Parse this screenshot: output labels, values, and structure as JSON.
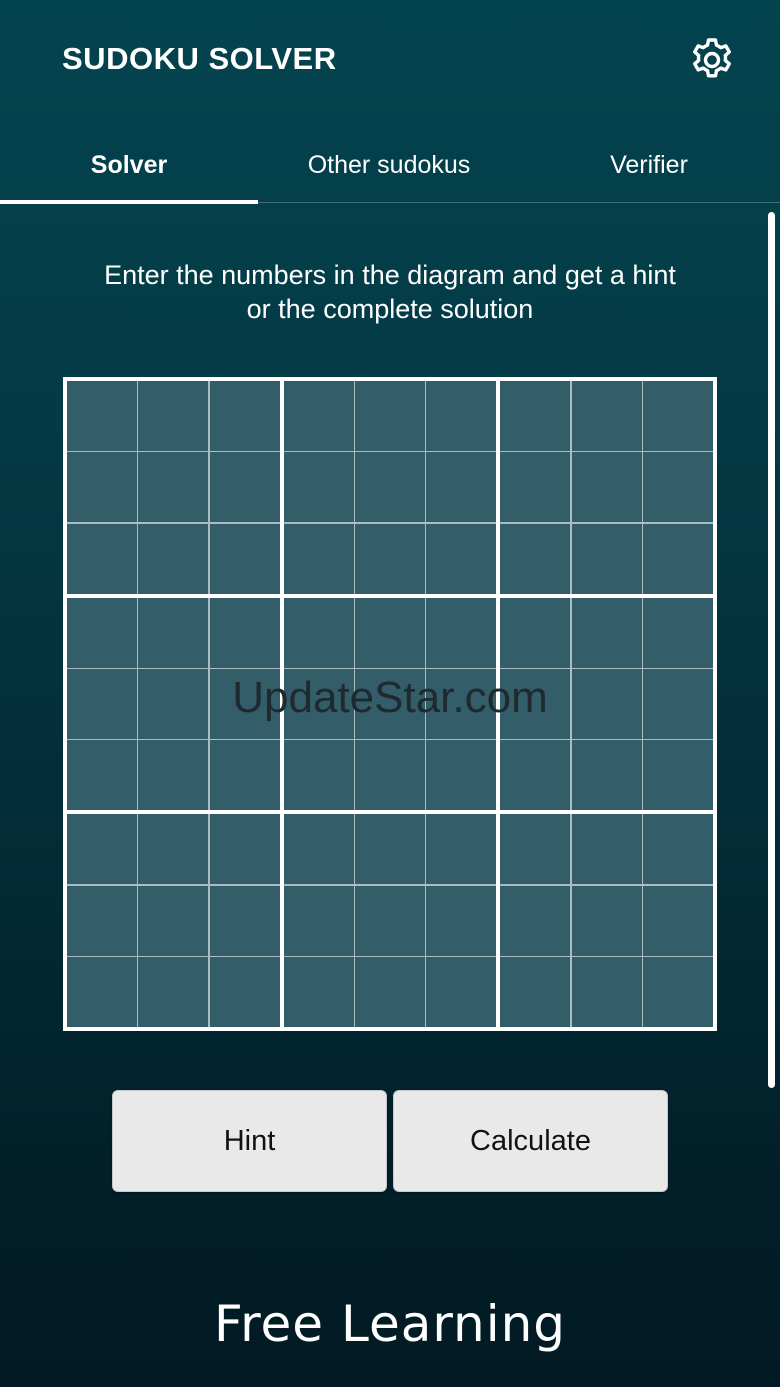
{
  "app": {
    "title": "SUDOKU SOLVER",
    "settings_icon": "gear-icon"
  },
  "tabs": [
    {
      "label": "Solver",
      "active": true
    },
    {
      "label": "Other sudokus",
      "active": false
    },
    {
      "label": "Verifier",
      "active": false
    }
  ],
  "instructions": {
    "line1": "Enter the numbers in the diagram and get a hint",
    "line2": "or the complete solution"
  },
  "board": {
    "size": 9,
    "cells": [
      [
        "",
        "",
        "",
        "",
        "",
        "",
        "",
        "",
        ""
      ],
      [
        "",
        "",
        "",
        "",
        "",
        "",
        "",
        "",
        ""
      ],
      [
        "",
        "",
        "",
        "",
        "",
        "",
        "",
        "",
        ""
      ],
      [
        "",
        "",
        "",
        "",
        "",
        "",
        "",
        "",
        ""
      ],
      [
        "",
        "",
        "",
        "",
        "",
        "",
        "",
        "",
        ""
      ],
      [
        "",
        "",
        "",
        "",
        "",
        "",
        "",
        "",
        ""
      ],
      [
        "",
        "",
        "",
        "",
        "",
        "",
        "",
        "",
        ""
      ],
      [
        "",
        "",
        "",
        "",
        "",
        "",
        "",
        "",
        ""
      ],
      [
        "",
        "",
        "",
        "",
        "",
        "",
        "",
        "",
        ""
      ]
    ]
  },
  "watermark": "UpdateStar.com",
  "buttons": {
    "hint": "Hint",
    "calculate": "Calculate"
  },
  "footer": {
    "logo_text": "Free Learning"
  },
  "colors": {
    "background_top": "#04444f",
    "background_bottom": "#021a23",
    "cell": "#335e69",
    "grid_major": "#ffffff",
    "button_bg": "#e9e9ea"
  }
}
